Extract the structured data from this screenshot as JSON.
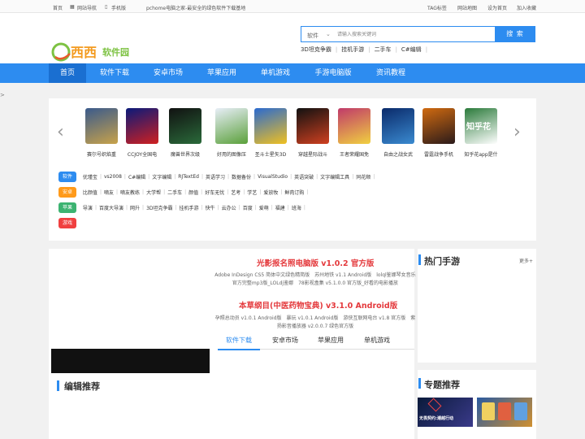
{
  "topbar": {
    "home": "首页",
    "site_nav": "网站导航",
    "mobile": "手机版",
    "slogan": "pchome电脑之家-最安全的绿色软件下载基地",
    "tags": "TAG标签",
    "sitemap": "网站地图",
    "set_home": "设为首页",
    "favorite": "加入收藏"
  },
  "logo": {
    "text": "西西",
    "subtext": "软件园"
  },
  "search": {
    "category": "软件",
    "placeholder": "请输入搜索关键词",
    "button": "搜 索",
    "hotwords": [
      "3D坦克争霸",
      "挂机手游",
      "二手车",
      "C#编辑"
    ]
  },
  "nav": {
    "items": [
      "首页",
      "软件下载",
      "安卓市场",
      "苹果应用",
      "单机游戏",
      "手游电脑版",
      "资讯教程"
    ]
  },
  "carousel": {
    "apps": [
      {
        "name": "赛尔号织焰重",
        "color1": "#3a5a8c",
        "color2": "#c8a24a"
      },
      {
        "name": "CCJOY全国电",
        "color1": "#0a1a7a",
        "color2": "#d02020"
      },
      {
        "name": "魔兽世界次级",
        "color1": "#111111",
        "color2": "#2a6a3a"
      },
      {
        "name": "好用的图像压",
        "color1": "#e8eef8",
        "color2": "#5aa03a"
      },
      {
        "name": "圣斗士星矢3D",
        "color1": "#2a6ad0",
        "color2": "#f0c020"
      },
      {
        "name": "穿越星际战斗",
        "color1": "#111111",
        "color2": "#d04020"
      },
      {
        "name": "王者荣耀国免",
        "color1": "#c03a6a",
        "color2": "#f0d040"
      },
      {
        "name": "自由之战女武",
        "color1": "#0a2a6a",
        "color2": "#3a8ad0"
      },
      {
        "name": "雷霆战争手机",
        "color1": "#d06a10",
        "color2": "#2a1a1a"
      },
      {
        "name": "知乎花app是什",
        "color1": "#2a7a3a",
        "color2": "#ffffff"
      }
    ],
    "zhihu_logo_text": "知乎花"
  },
  "tag_rows": [
    {
      "label": "软件",
      "color": "#2d8cf0",
      "items": [
        "优瑾宝",
        "vs2008",
        "C#编辑",
        "文字编辑",
        "RJTextEd",
        "英语学习",
        "数据备份",
        "VisualStudio",
        "英语突破",
        "文字编辑工具",
        "同花顺"
      ]
    },
    {
      "label": "安卓",
      "color": "#ff9a1a",
      "items": [
        "比颜值",
        "嘀友",
        "嘀友教练",
        "大学帮",
        "二手车",
        "颜值",
        "好车无忧",
        "艺考",
        "学艺",
        "爱放牧",
        "鲜肉订购"
      ]
    },
    {
      "label": "苹果",
      "color": "#3cb371",
      "items": [
        "导演",
        "百度大导演",
        "网升",
        "3D坦克争霸",
        "挂机手游",
        "快牛",
        "云办公",
        "百度",
        "爱萌",
        "福建",
        "班海"
      ]
    },
    {
      "label": "游戏",
      "color": "#f04040",
      "items": []
    }
  ],
  "news": {
    "headline1": "光影报名照电脑版 v1.0.2 官方版",
    "text1": "Adobe InDesign CS5 简体中文绿色精简版　苏州地铁 v1.1 Android版　lolql鉴娜琴女音乐 官方完整mp3版_LOLdj鉴娜　78影视盒集 v5.1.0.0 官方版_好看的电影播放",
    "headline2": "本草纲目(中医药物宝典) v3.1.0 Android版",
    "text2": "孕照总动员 v1.0.1 Android版　暴玩 v1.0.1 Android版　游侠互联网电台 v1.8 官方版　紫扬影音播放器 v2.0.0.7 绿色官方版"
  },
  "sub_tabs": [
    "软件下载",
    "安卓市场",
    "苹果应用",
    "单机游戏"
  ],
  "sections": {
    "editor_pick": "编辑推荐",
    "hot_games": "热门手游",
    "hot_games_more": "更多+",
    "topics": "专题推荐",
    "topic1_text": "无畏契约:潮越行动"
  },
  "edge_mark": ">"
}
